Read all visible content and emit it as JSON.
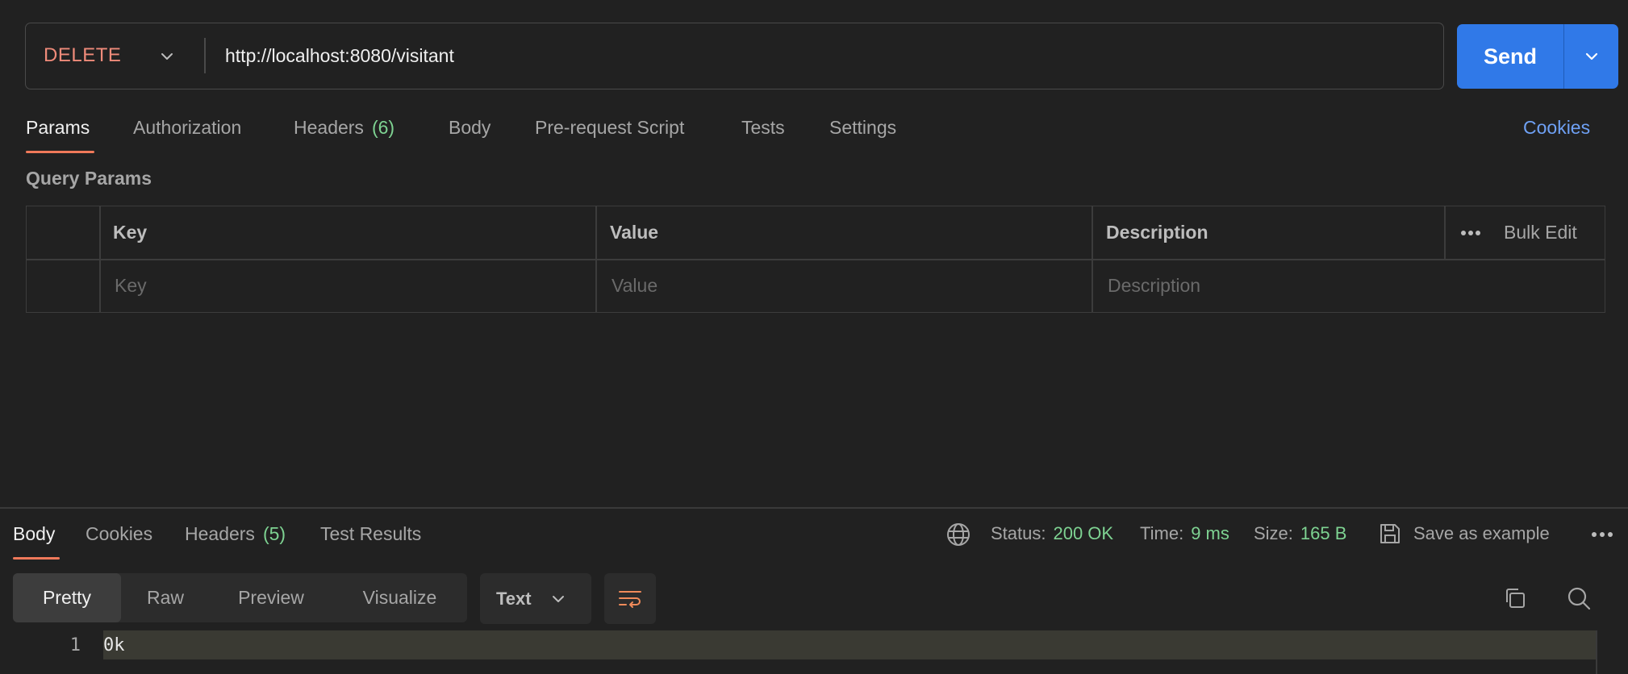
{
  "request": {
    "method": "DELETE",
    "url": "http://localhost:8080/visitant",
    "send_label": "Send"
  },
  "request_tabs": [
    {
      "label": "Params",
      "active": true
    },
    {
      "label": "Authorization"
    },
    {
      "label": "Headers",
      "count": "(6)"
    },
    {
      "label": "Body"
    },
    {
      "label": "Pre-request Script"
    },
    {
      "label": "Tests"
    },
    {
      "label": "Settings"
    }
  ],
  "cookies_link": "Cookies",
  "query_params": {
    "title": "Query Params",
    "columns": [
      "Key",
      "Value",
      "Description"
    ],
    "bulk_edit": "Bulk Edit",
    "placeholders": {
      "key": "Key",
      "value": "Value",
      "description": "Description"
    }
  },
  "response": {
    "tabs": [
      {
        "label": "Body",
        "active": true
      },
      {
        "label": "Cookies"
      },
      {
        "label": "Headers",
        "count": "(5)"
      },
      {
        "label": "Test Results"
      }
    ],
    "status_label": "Status:",
    "status_value": "200 OK",
    "time_label": "Time:",
    "time_value": "9 ms",
    "size_label": "Size:",
    "size_value": "165 B",
    "save_example": "Save as example",
    "view_modes": [
      "Pretty",
      "Raw",
      "Preview",
      "Visualize"
    ],
    "format": "Text",
    "lines": [
      {
        "number": "1",
        "text": "0k"
      }
    ]
  },
  "colors": {
    "method": "#f08b7a",
    "send_button": "#3079e8",
    "success": "#7ed392",
    "accent_underline": "#f0795a",
    "link": "#6fa1f5"
  },
  "icons": [
    "chevron-down-icon",
    "globe-icon",
    "save-icon",
    "more-icon",
    "wrap-lines-icon",
    "copy-icon",
    "search-icon"
  ]
}
